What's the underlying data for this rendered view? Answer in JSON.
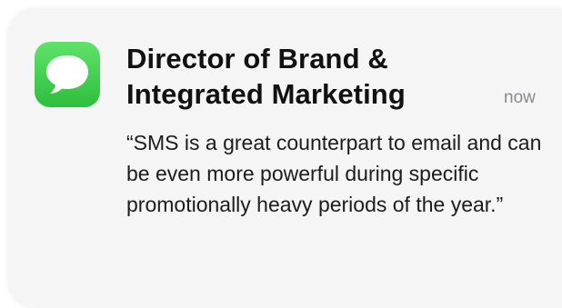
{
  "notification": {
    "app_icon": "messages-bubble-icon",
    "title": "Director of Brand & Integrated Marketing",
    "time": "now",
    "message": "“SMS is a great counterpart to email and can be even more powerful during specific promotionally heavy periods of the year.”"
  },
  "colors": {
    "card_background": "#f5f5f5",
    "icon_green_top": "#5fe36a",
    "icon_green_bottom": "#2fbe3e",
    "title_text": "#111111",
    "time_text": "#8a8a8f"
  }
}
